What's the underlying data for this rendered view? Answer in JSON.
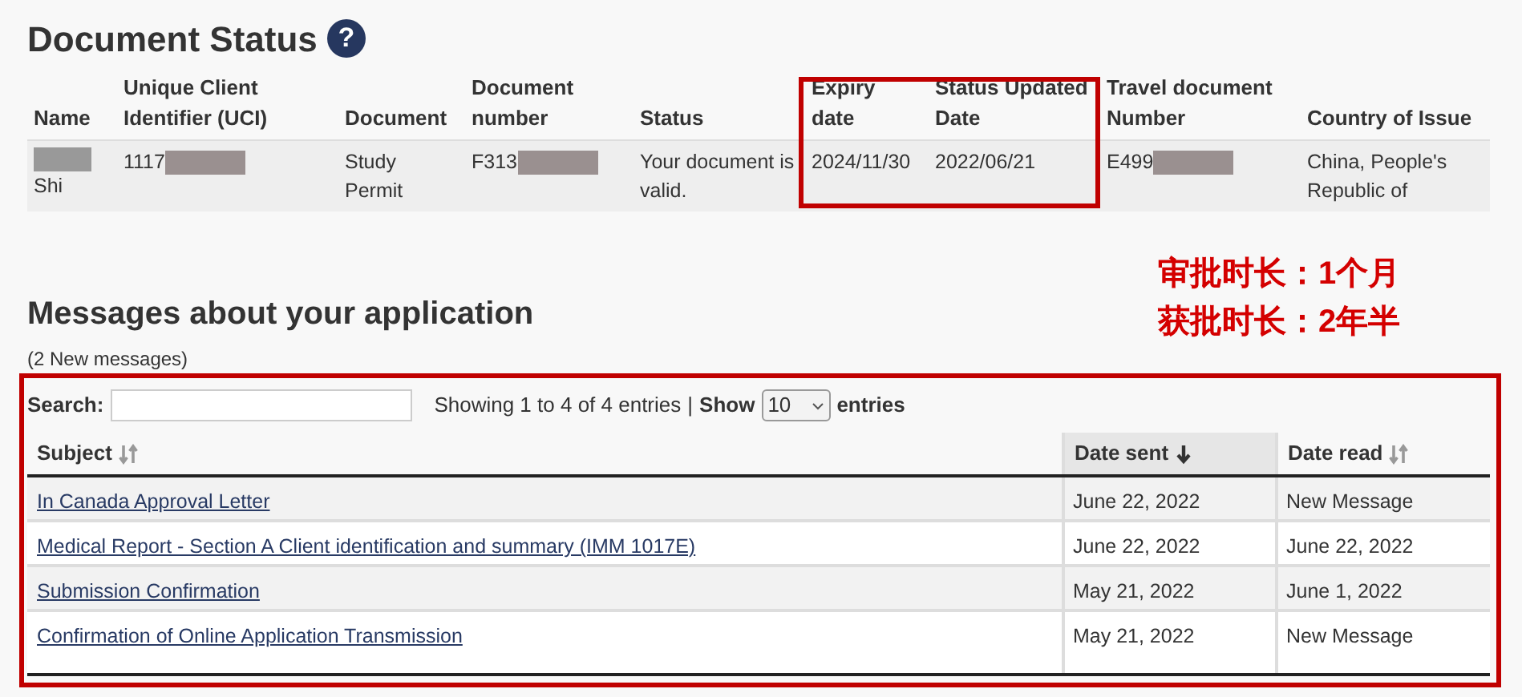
{
  "document_status": {
    "title": "Document Status",
    "help": "?",
    "columns": [
      {
        "label": "Name",
        "highlighted": false
      },
      {
        "label": "Unique Client Identifier (UCI)",
        "highlighted": false
      },
      {
        "label": "Document",
        "highlighted": false
      },
      {
        "label": "Document number",
        "highlighted": false
      },
      {
        "label": "Status",
        "highlighted": false
      },
      {
        "label": "Expiry date",
        "highlighted": true
      },
      {
        "label": "Status Updated Date",
        "highlighted": true
      },
      {
        "label": "Travel document Number",
        "highlighted": false
      },
      {
        "label": "Country of Issue",
        "highlighted": false
      }
    ],
    "row": [
      [
        {
          "kind": "redacted"
        },
        {
          "kind": "text",
          "text": "Shi"
        }
      ],
      [
        {
          "kind": "text",
          "text": "1117"
        },
        {
          "kind": "redacted"
        }
      ],
      [
        {
          "kind": "text",
          "text": "Study Permit"
        }
      ],
      [
        {
          "kind": "text",
          "text": "F313"
        },
        {
          "kind": "redacted"
        }
      ],
      [
        {
          "kind": "text",
          "text": "Your document is valid."
        }
      ],
      [
        {
          "kind": "text",
          "text": "2024/11/30"
        }
      ],
      [
        {
          "kind": "text",
          "text": "2022/06/21"
        }
      ],
      [
        {
          "kind": "text",
          "text": "E499"
        },
        {
          "kind": "redacted"
        }
      ],
      [
        {
          "kind": "text",
          "text": "China, People's Republic of"
        }
      ]
    ]
  },
  "annotation": [
    "审批时长：1个月",
    "获批时长：2年半"
  ],
  "messages": {
    "title": "Messages about your application",
    "count": "(2 New messages)",
    "highlighted": true,
    "search_label": "Search:",
    "info": "Showing 1 to 4 of 4 entries",
    "separator": "|",
    "show_label": "Show",
    "page_size": "10",
    "entries_label": "entries",
    "columns": [
      {
        "label": "Subject",
        "sorted": false
      },
      {
        "label": "Date sent",
        "sorted": true
      },
      {
        "label": "Date read",
        "sorted": false
      }
    ],
    "rows": [
      {
        "subject": "In Canada Approval Letter",
        "date_sent": "June 22, 2022",
        "date_read": "New Message"
      },
      {
        "subject": "Medical Report - Section A Client identification and summary (IMM 1017E)",
        "date_sent": "June 22, 2022",
        "date_read": "June 22, 2022"
      },
      {
        "subject": "Submission Confirmation",
        "date_sent": "May 21, 2022",
        "date_read": "June 1, 2022"
      },
      {
        "subject": "Confirmation of Online Application Transmission",
        "date_sent": "May 21, 2022",
        "date_read": "New Message"
      }
    ]
  }
}
